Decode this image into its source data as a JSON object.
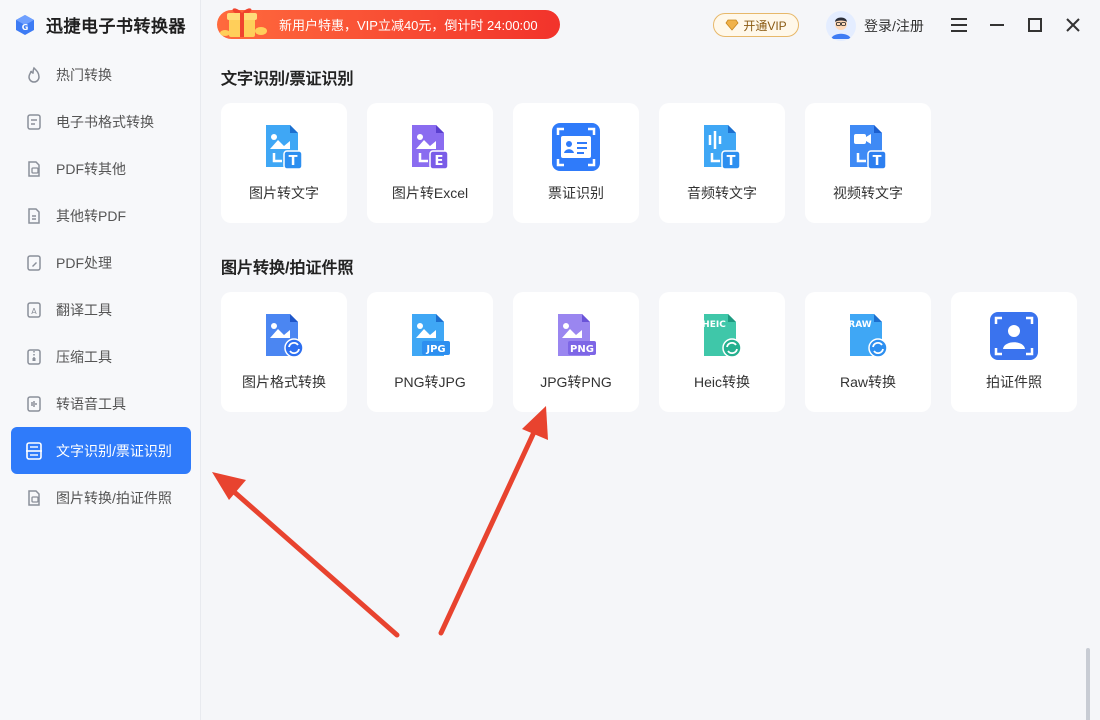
{
  "app": {
    "title": "迅捷电子书转换器"
  },
  "sidebar": {
    "items": [
      {
        "label": "热门转换",
        "icon": "fire-icon",
        "active": false
      },
      {
        "label": "电子书格式转换",
        "icon": "ebook-icon",
        "active": false
      },
      {
        "label": "PDF转其他",
        "icon": "pdf-export-icon",
        "active": false
      },
      {
        "label": "其他转PDF",
        "icon": "pdf-import-icon",
        "active": false
      },
      {
        "label": "PDF处理",
        "icon": "pdf-edit-icon",
        "active": false
      },
      {
        "label": "翻译工具",
        "icon": "translate-icon",
        "active": false
      },
      {
        "label": "压缩工具",
        "icon": "compress-icon",
        "active": false
      },
      {
        "label": "转语音工具",
        "icon": "voice-icon",
        "active": false
      },
      {
        "label": "文字识别/票证识别",
        "icon": "scan-icon",
        "active": true
      },
      {
        "label": "图片转换/拍证件照",
        "icon": "image-icon",
        "active": false
      }
    ]
  },
  "topbar": {
    "promo_text": "新用户特惠，VIP立减40元，倒计时 24:00:00",
    "vip_label": "开通VIP",
    "login_label": "登录/注册"
  },
  "sections": [
    {
      "title": "文字识别/票证识别",
      "cards": [
        {
          "label": "图片转文字",
          "icon": "image-to-text-icon"
        },
        {
          "label": "图片转Excel",
          "icon": "image-to-excel-icon"
        },
        {
          "label": "票证识别",
          "icon": "id-card-recognition-icon"
        },
        {
          "label": "音频转文字",
          "icon": "audio-to-text-icon"
        },
        {
          "label": "视频转文字",
          "icon": "video-to-text-icon"
        }
      ]
    },
    {
      "title": "图片转换/拍证件照",
      "cards": [
        {
          "label": "图片格式转换",
          "icon": "image-format-convert-icon"
        },
        {
          "label": "PNG转JPG",
          "icon": "png-to-jpg-icon",
          "badge": "JPG"
        },
        {
          "label": "JPG转PNG",
          "icon": "jpg-to-png-icon",
          "badge": "PNG"
        },
        {
          "label": "Heic转换",
          "icon": "heic-convert-icon",
          "badge": "HEIC"
        },
        {
          "label": "Raw转换",
          "icon": "raw-convert-icon",
          "badge": "RAW"
        },
        {
          "label": "拍证件照",
          "icon": "id-photo-icon"
        }
      ]
    }
  ],
  "colors": {
    "accent": "#2f7bfa",
    "promo": "#f2332b",
    "arrow": "#e8432f"
  }
}
